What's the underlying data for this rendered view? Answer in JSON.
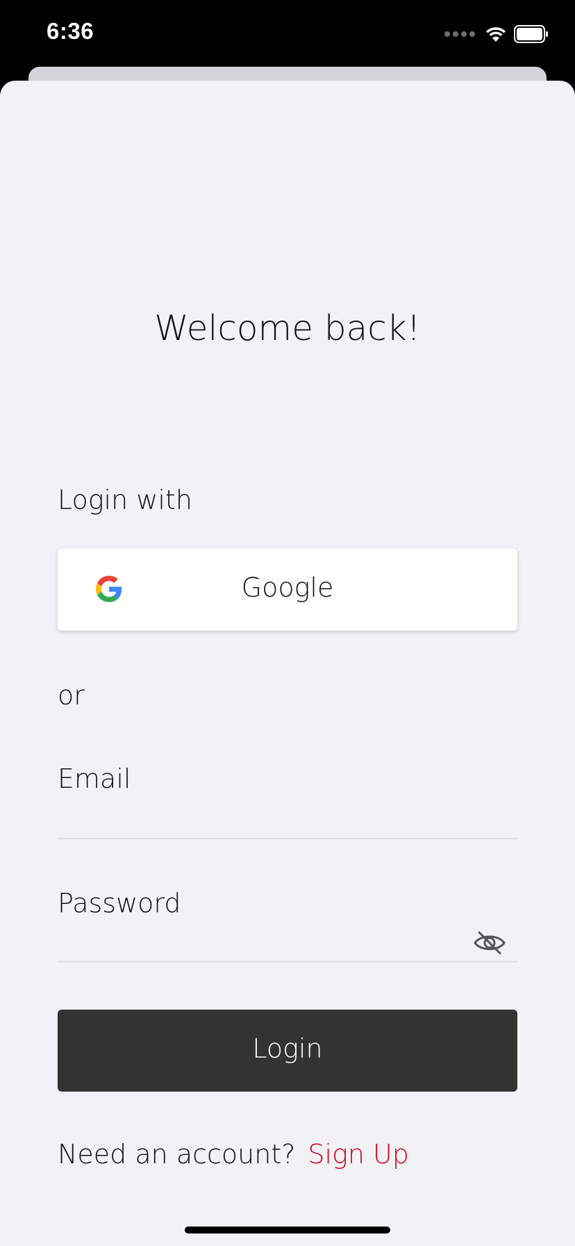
{
  "status_bar": {
    "time": "6:36"
  },
  "welcome_title": "Welcome back!",
  "login_with_label": "Login with",
  "google_button": {
    "label": "Google",
    "icon": "google-logo-icon"
  },
  "or_label": "or",
  "email_field": {
    "label": "Email",
    "value": ""
  },
  "password_field": {
    "label": "Password",
    "value": "",
    "toggle_icon": "eye-slash-icon"
  },
  "login_button": {
    "label": "Login"
  },
  "signup": {
    "prompt": "Need an account?",
    "link": "Sign Up"
  },
  "colors": {
    "accent_link": "#d0021b",
    "primary_button": "#333333",
    "background": "#f2f1f6"
  }
}
